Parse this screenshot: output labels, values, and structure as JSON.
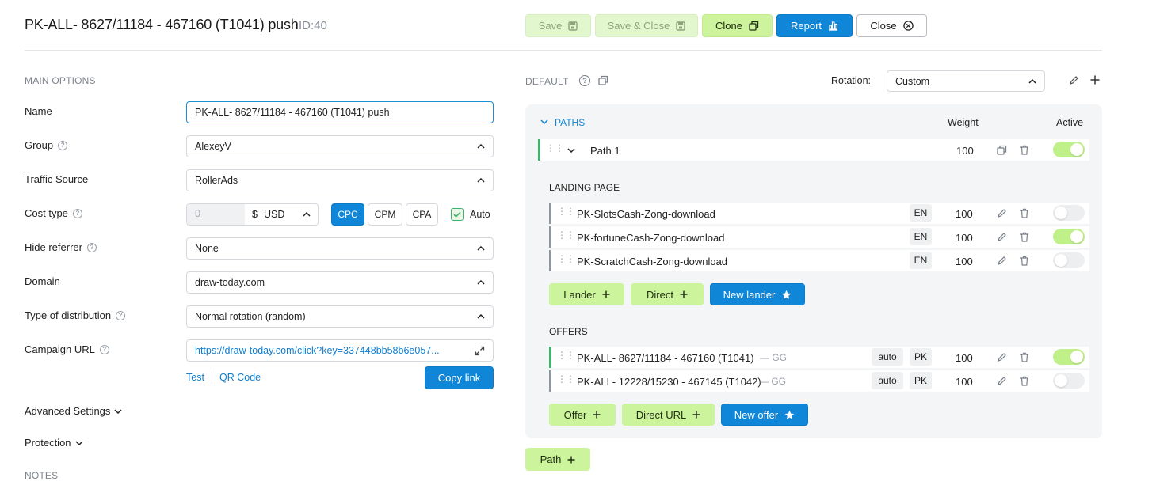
{
  "header": {
    "title": "PK-ALL- 8627/11184 - 467160 (T1041) push",
    "id_label": "ID:40",
    "buttons": {
      "save": "Save",
      "save_close": "Save & Close",
      "clone": "Clone",
      "report": "Report",
      "close": "Close"
    }
  },
  "main_options": {
    "section_title": "MAIN OPTIONS",
    "name": {
      "label": "Name",
      "value": "PK-ALL- 8627/11184 - 467160 (T1041) push"
    },
    "group": {
      "label": "Group",
      "value": "AlexeyV"
    },
    "traffic_source": {
      "label": "Traffic Source",
      "value": "RollerAds"
    },
    "cost_type": {
      "label": "Cost type",
      "cost_value": "0",
      "currency_symbol": "$",
      "currency": "USD",
      "models": [
        "CPC",
        "CPM",
        "CPA"
      ],
      "selected_model": "CPC",
      "auto_label": "Auto",
      "auto_checked": true
    },
    "hide_referrer": {
      "label": "Hide referrer",
      "value": "None"
    },
    "domain": {
      "label": "Domain",
      "value": "draw-today.com"
    },
    "distribution": {
      "label": "Type of distribution",
      "value": "Normal rotation (random)"
    },
    "campaign_url": {
      "label": "Campaign URL",
      "value": "https://draw-today.com/click?key=337448bb58b6e057...",
      "test_link": "Test",
      "qr_link": "QR Code",
      "copy_button": "Copy link"
    },
    "advanced_settings": "Advanced Settings",
    "protection": "Protection",
    "notes": "NOTES"
  },
  "default_panel": {
    "title": "DEFAULT",
    "rotation_label": "Rotation:",
    "rotation_value": "Custom",
    "paths_header": "PATHS",
    "weight_header": "Weight",
    "active_header": "Active",
    "path": {
      "name": "Path 1",
      "weight": "100",
      "active": true
    },
    "landing_title": "LANDING PAGE",
    "landers": [
      {
        "name": "PK-SlotsCash-Zong-download",
        "lang": "EN",
        "weight": "100",
        "active": false
      },
      {
        "name": "PK-fortuneCash-Zong-download",
        "lang": "EN",
        "weight": "100",
        "active": true
      },
      {
        "name": "PK-ScratchCash-Zong-download",
        "lang": "EN",
        "weight": "100",
        "active": false
      }
    ],
    "lander_buttons": {
      "lander": "Lander",
      "direct": "Direct",
      "new_lander": "New lander"
    },
    "offers_title": "OFFERS",
    "offers": [
      {
        "name": "PK-ALL- 8627/11184 - 467160 (T1041)",
        "network": "— GG",
        "payout": "auto",
        "country": "PK",
        "weight": "100",
        "active": true
      },
      {
        "name": "PK-ALL- 12228/15230 - 467145 (T1042)",
        "network": "— GG",
        "payout": "auto",
        "country": "PK",
        "weight": "100",
        "active": false
      }
    ],
    "offer_buttons": {
      "offer": "Offer",
      "direct_url": "Direct URL",
      "new_offer": "New offer"
    },
    "path_button": "Path"
  },
  "colors": {
    "accent_blue": "#0f86d8",
    "accent_green": "#ccf49c",
    "path_bar": "#3fb36b",
    "row_bar_gray": "#8e959e"
  }
}
